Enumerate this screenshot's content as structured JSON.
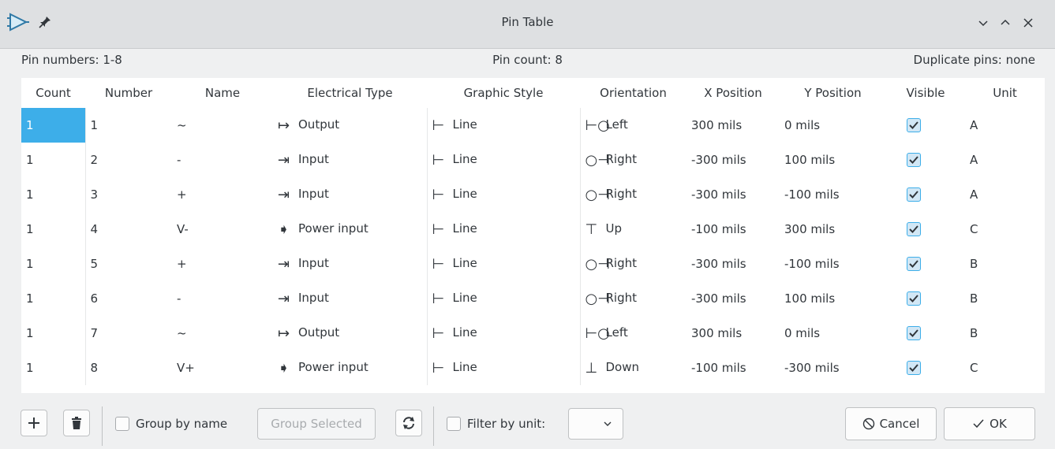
{
  "window": {
    "title": "Pin Table",
    "icons": {
      "app": "kicad-symbol-icon",
      "pin": "pin-icon",
      "minimize": "chevron-down-icon",
      "maximize": "chevron-up-icon",
      "close": "close-icon"
    }
  },
  "summary": {
    "pin_numbers": "Pin numbers: 1-8",
    "pin_count": "Pin count: 8",
    "duplicate_pins": "Duplicate pins: none"
  },
  "table": {
    "headers": [
      "Count",
      "Number",
      "Name",
      "Electrical Type",
      "Graphic Style",
      "Orientation",
      "X Position",
      "Y Position",
      "Visible",
      "Unit"
    ],
    "rows": [
      {
        "count": "1",
        "number": "1",
        "name": "~",
        "etype": "Output",
        "etype_icon": "↦",
        "style": "Line",
        "orient": "Left",
        "orient_icon": "⊢○",
        "x": "300 mils",
        "y": "0 mils",
        "visible": true,
        "unit": "A"
      },
      {
        "count": "1",
        "number": "2",
        "name": "-",
        "etype": "Input",
        "etype_icon": "⇥",
        "style": "Line",
        "orient": "Right",
        "orient_icon": "○⊣",
        "x": "-300 mils",
        "y": "100 mils",
        "visible": true,
        "unit": "A"
      },
      {
        "count": "1",
        "number": "3",
        "name": "+",
        "etype": "Input",
        "etype_icon": "⇥",
        "style": "Line",
        "orient": "Right",
        "orient_icon": "○⊣",
        "x": "-300 mils",
        "y": "-100 mils",
        "visible": true,
        "unit": "A"
      },
      {
        "count": "1",
        "number": "4",
        "name": "V-",
        "etype": "Power input",
        "etype_icon": "➧",
        "style": "Line",
        "orient": "Up",
        "orient_icon": "⊤",
        "x": "-100 mils",
        "y": "300 mils",
        "visible": true,
        "unit": "C"
      },
      {
        "count": "1",
        "number": "5",
        "name": "+",
        "etype": "Input",
        "etype_icon": "⇥",
        "style": "Line",
        "orient": "Right",
        "orient_icon": "○⊣",
        "x": "-300 mils",
        "y": "-100 mils",
        "visible": true,
        "unit": "B"
      },
      {
        "count": "1",
        "number": "6",
        "name": "-",
        "etype": "Input",
        "etype_icon": "⇥",
        "style": "Line",
        "orient": "Right",
        "orient_icon": "○⊣",
        "x": "-300 mils",
        "y": "100 mils",
        "visible": true,
        "unit": "B"
      },
      {
        "count": "1",
        "number": "7",
        "name": "~",
        "etype": "Output",
        "etype_icon": "↦",
        "style": "Line",
        "orient": "Left",
        "orient_icon": "⊢○",
        "x": "300 mils",
        "y": "0 mils",
        "visible": true,
        "unit": "B"
      },
      {
        "count": "1",
        "number": "8",
        "name": "V+",
        "etype": "Power input",
        "etype_icon": "➧",
        "style": "Line",
        "orient": "Down",
        "orient_icon": "⊥",
        "x": "-100 mils",
        "y": "-300 mils",
        "visible": true,
        "unit": "C"
      }
    ],
    "style_icon": "⊢",
    "selected_cell": "row 1, Count",
    "accent": "#3daee9"
  },
  "toolbar": {
    "add_icon": "plus-icon",
    "delete_icon": "trash-icon",
    "group_by_name": "Group by name",
    "group_selected": "Group Selected",
    "refresh_icon": "refresh-icon",
    "filter_by_unit": "Filter by unit:",
    "filter_value": "",
    "cancel": "Cancel",
    "ok": "OK",
    "cancel_icon": "cancel-circle-icon",
    "ok_icon": "checkmark-icon"
  }
}
